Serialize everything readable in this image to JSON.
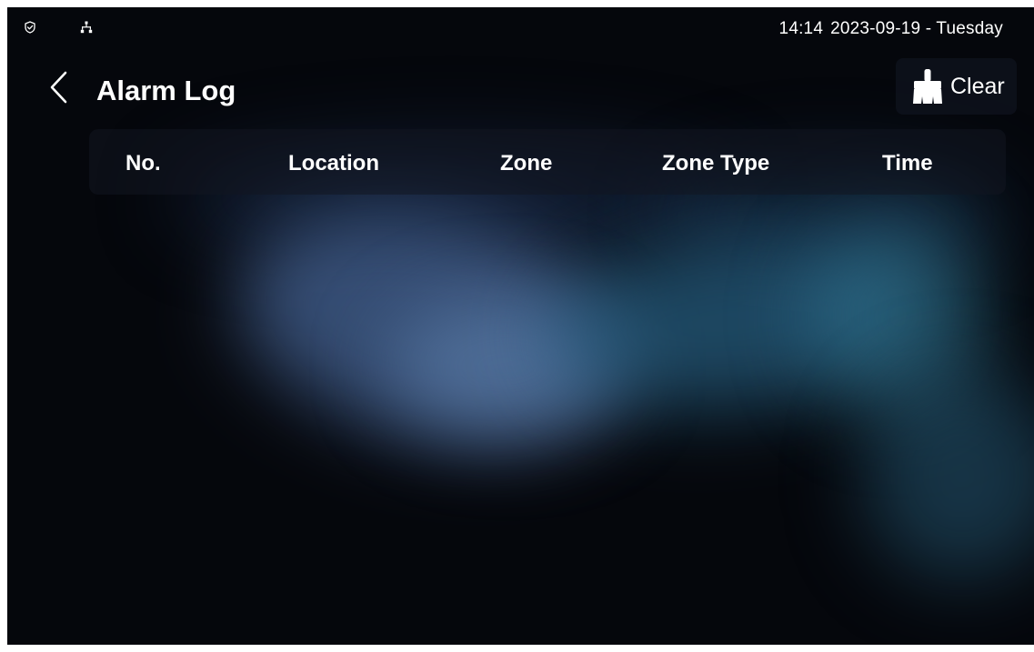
{
  "status_bar": {
    "time": "14:14",
    "date": "2023-09-19 - Tuesday",
    "icons": [
      "shield-icon",
      "network-icon"
    ]
  },
  "header": {
    "back_icon": "chevron-left-icon",
    "title": "Alarm Log",
    "clear_button": {
      "icon": "broom-icon",
      "label": "Clear"
    }
  },
  "table": {
    "columns": [
      "No.",
      "Location",
      "Zone",
      "Zone Type",
      "Time"
    ],
    "rows": []
  },
  "colors": {
    "background": "#05070c",
    "text": "#ffffff",
    "button_bg": "#0e121c",
    "accent_blue": "#466496",
    "accent_teal": "#265c7d"
  }
}
